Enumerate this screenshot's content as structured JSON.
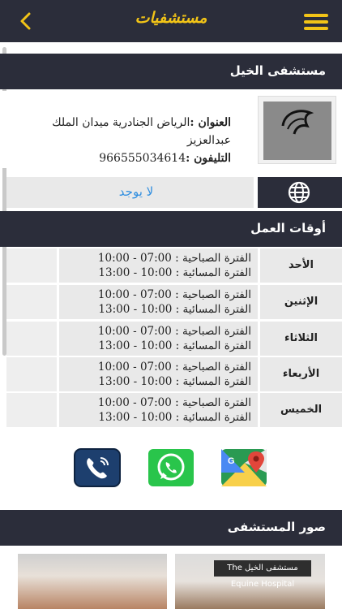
{
  "header": {
    "title": "مستشفيات"
  },
  "hospital": {
    "name": "مستشفى الخيل",
    "logo_text_ar": "مستشفى الخيل",
    "logo_text_en": "The Equine Hospital",
    "address_label": "العنوان :",
    "address_value": "الرياض الجنادرية ميدان الملك عبدالعزيز",
    "phone_label": "التليفون :",
    "phone_value": "966555034614",
    "website": "لا يوجد"
  },
  "hours": {
    "title": "أوقات العمل",
    "rows": [
      {
        "day": "الأحد",
        "morning_label": "الفترة الصباحية :",
        "morning": "07:00 - 10:00",
        "evening_label": "الفترة المسائية :",
        "evening": "10:00 - 13:00"
      },
      {
        "day": "الإثنين",
        "morning_label": "الفترة الصباحية :",
        "morning": "07:00 - 10:00",
        "evening_label": "الفترة المسائية :",
        "evening": "10:00 - 13:00"
      },
      {
        "day": "الثلاثاء",
        "morning_label": "الفترة الصباحية :",
        "morning": "07:00 - 10:00",
        "evening_label": "الفترة المسائية :",
        "evening": "10:00 - 13:00"
      },
      {
        "day": "الأربعاء",
        "morning_label": "الفترة الصباحية :",
        "morning": "07:00 - 10:00",
        "evening_label": "الفترة المسائية :",
        "evening": "10:00 - 13:00"
      },
      {
        "day": "الخميس",
        "morning_label": "الفترة الصباحية :",
        "morning": "07:00 - 10:00",
        "evening_label": "الفترة المسائية :",
        "evening": "10:00 - 13:00"
      }
    ]
  },
  "actions": {
    "icons": [
      "phone-icon",
      "whatsapp-icon",
      "google-maps-icon"
    ],
    "colors": {
      "phone": "#1d3f6e",
      "whatsapp": "#29c54b"
    }
  },
  "photos": {
    "title": "صور المستشفى",
    "sign_text": "مستشفى الخيل The Equine Hospital"
  },
  "colors": {
    "bar": "#2b2d3a",
    "accent": "#f2c417",
    "link": "#2f8ee0"
  }
}
